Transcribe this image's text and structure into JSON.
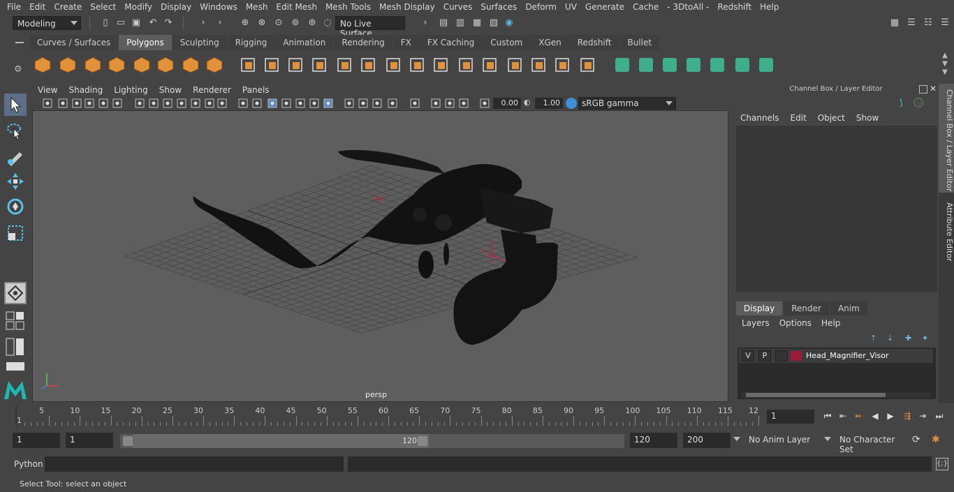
{
  "menubar": [
    "File",
    "Edit",
    "Create",
    "Select",
    "Modify",
    "Display",
    "Windows",
    "Mesh",
    "Edit Mesh",
    "Mesh Tools",
    "Mesh Display",
    "Curves",
    "Surfaces",
    "Deform",
    "UV",
    "Generate",
    "Cache",
    "- 3DtoAll -",
    "Redshift",
    "Help"
  ],
  "status": {
    "mode": "Modeling",
    "live_surface": "No Live Surface"
  },
  "shelf": {
    "tabs": [
      "Curves / Surfaces",
      "Polygons",
      "Sculpting",
      "Rigging",
      "Animation",
      "Rendering",
      "FX",
      "FX Caching",
      "Custom",
      "XGen",
      "Redshift",
      "Bullet"
    ],
    "active_tab": "Polygons"
  },
  "panel": {
    "menu": [
      "View",
      "Shading",
      "Lighting",
      "Show",
      "Renderer",
      "Panels"
    ],
    "exposure": "0.00",
    "gamma": "1.00",
    "color_space": "sRGB gamma",
    "camera_label": "persp"
  },
  "channel_box": {
    "title": "Channel Box / Layer Editor",
    "menu": [
      "Channels",
      "Edit",
      "Object",
      "Show"
    ]
  },
  "layer_editor": {
    "tabs": [
      "Display",
      "Render",
      "Anim"
    ],
    "active_tab": "Display",
    "menu": [
      "Layers",
      "Options",
      "Help"
    ],
    "layers": [
      {
        "v": "V",
        "p": "P",
        "name": "Head_Magnifier_Visor",
        "color": "#9b1a35"
      }
    ]
  },
  "side_tabs": [
    "Channel Box / Layer Editor",
    "Attribute Editor"
  ],
  "timeline": {
    "ticks": [
      "5",
      "10",
      "15",
      "20",
      "25",
      "30",
      "35",
      "40",
      "45",
      "50",
      "55",
      "60",
      "65",
      "70",
      "75",
      "80",
      "85",
      "90",
      "95",
      "100",
      "105",
      "110",
      "115",
      "12"
    ],
    "start_label": "1",
    "current_frame": "1"
  },
  "range": {
    "start": "1",
    "playback_start": "1",
    "range_start": "1",
    "range_end": "120",
    "playback_end": "120",
    "end": "200",
    "anim_layer": "No Anim Layer",
    "character_set": "No Character Set"
  },
  "command": {
    "label": "Python"
  },
  "help_line": "Select Tool: select an object",
  "colors": {
    "accent_orange": "#e0913a",
    "shelf_green": "#3fae8c",
    "layer_red": "#9b1a35"
  }
}
